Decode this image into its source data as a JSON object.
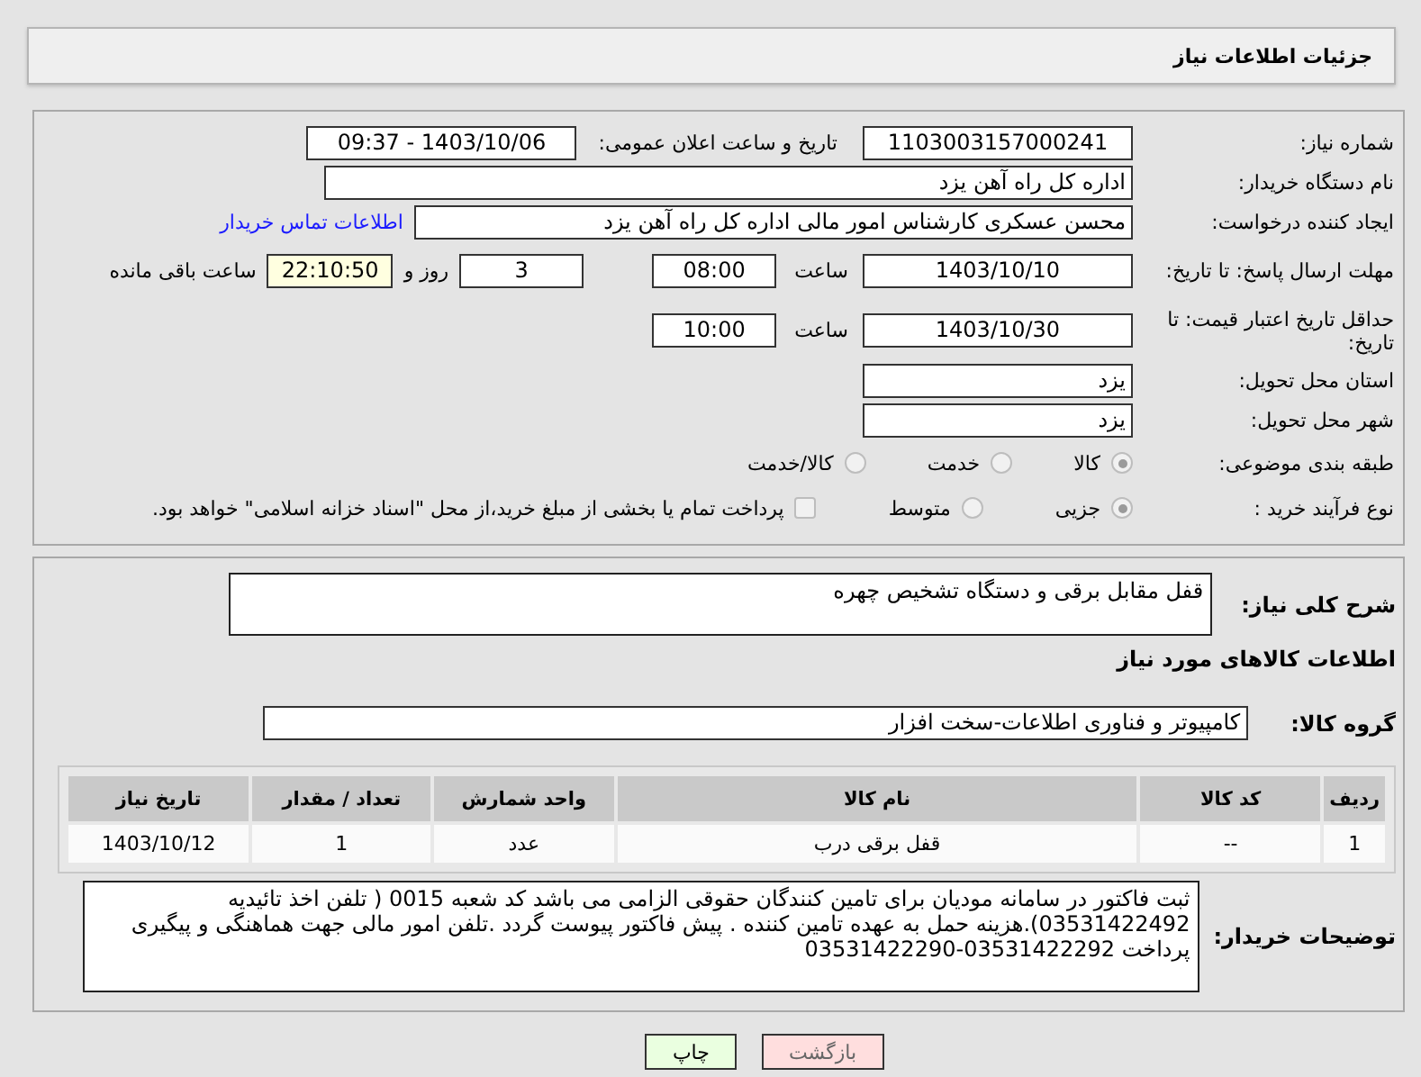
{
  "header": {
    "title": "جزئیات اطلاعات نیاز"
  },
  "need_number": {
    "label": "شماره نیاز:",
    "value": "1103003157000241"
  },
  "announce": {
    "label": "تاریخ و ساعت اعلان عمومی:",
    "value": "1403/10/06 - 09:37"
  },
  "buyer": {
    "label": "نام دستگاه خریدار:",
    "value": "اداره کل راه آهن یزد"
  },
  "requester": {
    "label": "ایجاد کننده درخواست:",
    "value": "محسن عسکری کارشناس امور مالی اداره کل راه آهن یزد",
    "link": "اطلاعات تماس خریدار"
  },
  "deadline": {
    "label": "مهلت ارسال پاسخ: تا تاریخ:",
    "date": "1403/10/10",
    "time_label": "ساعت",
    "time": "08:00",
    "days": "3",
    "days_label": "روز و",
    "remaining": "22:10:50",
    "remaining_label": "ساعت باقی مانده"
  },
  "validity": {
    "label": "حداقل تاریخ اعتبار قیمت: تا تاریخ:",
    "date": "1403/10/30",
    "time_label": "ساعت",
    "time": "10:00"
  },
  "province": {
    "label": "استان محل تحویل:",
    "value": "یزد"
  },
  "city": {
    "label": "شهر محل تحویل:",
    "value": "یزد"
  },
  "category": {
    "label": "طبقه بندی موضوعی:",
    "options": [
      {
        "label": "کالا",
        "selected": true
      },
      {
        "label": "خدمت",
        "selected": false
      },
      {
        "label": "کالا/خدمت",
        "selected": false
      }
    ]
  },
  "process": {
    "label": "نوع فرآیند خرید :",
    "options": [
      {
        "label": "جزیی",
        "selected": true
      },
      {
        "label": "متوسط",
        "selected": false
      }
    ],
    "payment": {
      "checked": false,
      "label": "پرداخت تمام یا بخشی از مبلغ خرید،از محل \"اسناد خزانه اسلامی\" خواهد بود."
    }
  },
  "description": {
    "label": "شرح کلی نیاز:",
    "value": "قفل مقابل برقی و دستگاه تشخیص چهره"
  },
  "goods_title": "اطلاعات کالاهای مورد نیاز",
  "goods_group": {
    "label": "گروه کالا:",
    "value": "کامپیوتر و فناوری اطلاعات-سخت افزار"
  },
  "table": {
    "columns": [
      "ردیف",
      "کد کالا",
      "نام کالا",
      "واحد شمارش",
      "تعداد / مقدار",
      "تاریخ نیاز"
    ],
    "rows": [
      [
        "1",
        "--",
        "قفل برقی درب",
        "عدد",
        "1",
        "1403/10/12"
      ]
    ]
  },
  "notes": {
    "label": "توضیحات خریدار:",
    "value": "ثبت فاکتور در سامانه مودیان برای تامین کنندگان حقوقی الزامی می باشد کد شعبه 0015 ( تلفن اخذ تائیدیه 03531422492).هزینه حمل به عهده تامین کننده . پیش فاکتور پیوست گردد .تلفن امور مالی جهت هماهنگی و پیگیری پرداخت 03531422292-03531422290"
  },
  "buttons": [
    {
      "label": "بازگشت",
      "kind": "back"
    },
    {
      "label": "چاپ",
      "kind": "print"
    }
  ]
}
